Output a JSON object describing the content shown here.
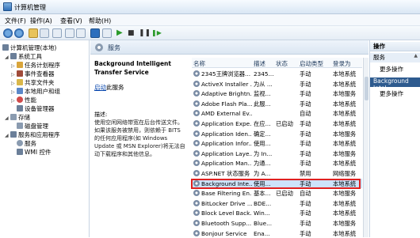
{
  "window": {
    "title": "计算机管理"
  },
  "menu": [
    "文件(F)",
    "操作(A)",
    "查看(V)",
    "帮助(H)"
  ],
  "tree": {
    "root": "计算机管理(本地)",
    "nodes": [
      {
        "label": "系统工具",
        "level": 1,
        "exp": "◢",
        "color": "#6b7f99"
      },
      {
        "label": "任务计划程序",
        "level": 2,
        "exp": "▷",
        "color": "#d9a53c"
      },
      {
        "label": "事件查看器",
        "level": 2,
        "exp": "▷",
        "color": "#a04b3a"
      },
      {
        "label": "共享文件夹",
        "level": 2,
        "exp": "▷",
        "color": "#d9b74a"
      },
      {
        "label": "本地用户和组",
        "level": 2,
        "exp": "▷",
        "color": "#5b88c9"
      },
      {
        "label": "性能",
        "level": 2,
        "exp": "▷",
        "color": "#d04a4a"
      },
      {
        "label": "设备管理器",
        "level": 2,
        "exp": "",
        "color": "#6b7f99"
      },
      {
        "label": "存储",
        "level": 1,
        "exp": "◢",
        "color": "#8a9bb0"
      },
      {
        "label": "磁盘管理",
        "level": 2,
        "exp": "",
        "color": "#8a9bb0"
      },
      {
        "label": "服务和应用程序",
        "level": 1,
        "exp": "◢",
        "color": "#6b7f99"
      },
      {
        "label": "服务",
        "level": 2,
        "exp": "",
        "color": "#8a9bb0"
      },
      {
        "label": "WMI 控件",
        "level": 2,
        "exp": "",
        "color": "#6b7f99"
      }
    ]
  },
  "center": {
    "title": "服务",
    "selected_service": "Background Intelligent Transfer Service",
    "link": "启动",
    "link_after": "此服务",
    "desc_label": "描述:",
    "desc_body": "使用空闲网络带宽在后台传送文件。如果该服务被禁用，则依赖于 BITS 的任何应用程序(如 Windows Update 或 MSN Explorer)将无法自动下载程序和其他信息。"
  },
  "columns": [
    "名称",
    "描述",
    "状态",
    "启动类型",
    "登录为"
  ],
  "rows": [
    {
      "name": "2345王牌浏览器...",
      "desc": "2345...",
      "status": "",
      "start": "手动",
      "logon": "本地系统"
    },
    {
      "name": "ActiveX Installer ...",
      "desc": "为从 ...",
      "status": "",
      "start": "手动",
      "logon": "本地系统"
    },
    {
      "name": "Adaptive Brightn...",
      "desc": "监视...",
      "status": "",
      "start": "手动",
      "logon": "本地服务"
    },
    {
      "name": "Adobe Flash Pla...",
      "desc": "此服...",
      "status": "",
      "start": "手动",
      "logon": "本地系统"
    },
    {
      "name": "AMD External Ev...",
      "desc": "",
      "status": "",
      "start": "自动",
      "logon": "本地系统"
    },
    {
      "name": "Application Expe...",
      "desc": "在应...",
      "status": "已启动",
      "start": "手动",
      "logon": "本地系统"
    },
    {
      "name": "Application Iden...",
      "desc": "确定...",
      "status": "",
      "start": "手动",
      "logon": "本地服务"
    },
    {
      "name": "Application Infor...",
      "desc": "使用...",
      "status": "",
      "start": "手动",
      "logon": "本地系统"
    },
    {
      "name": "Application Laye...",
      "desc": "为 In...",
      "status": "",
      "start": "手动",
      "logon": "本地服务"
    },
    {
      "name": "Application Man...",
      "desc": "为通...",
      "status": "",
      "start": "手动",
      "logon": "本地系统"
    },
    {
      "name": "ASP.NET 状态服务",
      "desc": "为 A...",
      "status": "",
      "start": "禁用",
      "logon": "网络服务"
    },
    {
      "name": "Background Inte...",
      "desc": "使用...",
      "status": "",
      "start": "手动",
      "logon": "本地系统",
      "selected": true
    },
    {
      "name": "Base Filtering En...",
      "desc": "基本...",
      "status": "已启动",
      "start": "自动",
      "logon": "本地服务"
    },
    {
      "name": "BitLocker Drive ...",
      "desc": "BDE...",
      "status": "",
      "start": "手动",
      "logon": "本地系统"
    },
    {
      "name": "Block Level Back...",
      "desc": "Win...",
      "status": "",
      "start": "手动",
      "logon": "本地系统"
    },
    {
      "name": "Bluetooth Supp...",
      "desc": "Blue...",
      "status": "",
      "start": "手动",
      "logon": "本地服务"
    },
    {
      "name": "Bonjour Service",
      "desc": "Ena...",
      "status": "",
      "start": "手动",
      "logon": "本地系统"
    }
  ],
  "actions": {
    "header": "操作",
    "group1": "服务",
    "group1_more": "更多操作",
    "group2": "Background Intel",
    "group2_more": "更多操作"
  }
}
